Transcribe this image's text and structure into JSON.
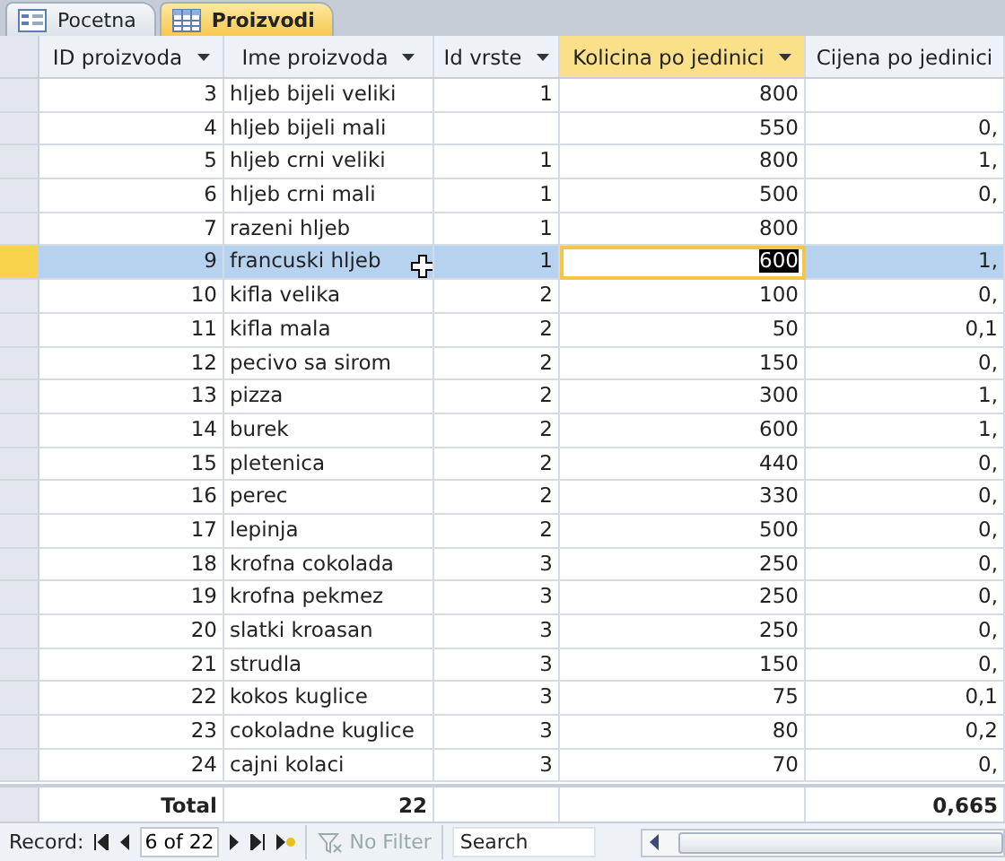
{
  "tabs": [
    {
      "label": "Pocetna",
      "kind": "form",
      "selected": false
    },
    {
      "label": "Proizvodi",
      "kind": "table",
      "selected": true
    }
  ],
  "table": {
    "columns": [
      {
        "label": "ID proizvoda",
        "selected": false,
        "dropdown": true
      },
      {
        "label": "Ime proizvoda",
        "selected": false,
        "dropdown": true
      },
      {
        "label": "Id vrste",
        "selected": false,
        "dropdown": true
      },
      {
        "label": "Kolicina po jedinici",
        "selected": true,
        "dropdown": true
      },
      {
        "label": "Cijena po jedinici",
        "selected": false,
        "dropdown": false
      }
    ],
    "rows": [
      {
        "cells": [
          "3",
          "hljeb bijeli veliki",
          "1",
          "800",
          null
        ],
        "selected": false
      },
      {
        "cells": [
          "4",
          "hljeb bijeli mali",
          null,
          "550",
          "0,"
        ],
        "selected": false
      },
      {
        "cells": [
          "5",
          "hljeb crni veliki",
          "1",
          "800",
          "1,"
        ],
        "selected": false
      },
      {
        "cells": [
          "6",
          "hljeb crni mali",
          "1",
          "500",
          "0,"
        ],
        "selected": false
      },
      {
        "cells": [
          "7",
          "razeni hljeb",
          "1",
          "800",
          null
        ],
        "selected": false
      },
      {
        "cells": [
          "9",
          "francuski hljeb",
          "1",
          "600",
          "1,"
        ],
        "selected": true
      },
      {
        "cells": [
          "10",
          "kifla velika",
          "2",
          "100",
          "0,"
        ],
        "selected": false
      },
      {
        "cells": [
          "11",
          "kifla mala",
          "2",
          "50",
          "0,1"
        ],
        "selected": false
      },
      {
        "cells": [
          "12",
          "pecivo sa sirom",
          "2",
          "150",
          "0,"
        ],
        "selected": false
      },
      {
        "cells": [
          "13",
          "pizza",
          "2",
          "300",
          "1,"
        ],
        "selected": false
      },
      {
        "cells": [
          "14",
          "burek",
          "2",
          "600",
          "1,"
        ],
        "selected": false
      },
      {
        "cells": [
          "15",
          "pletenica",
          "2",
          "440",
          "0,"
        ],
        "selected": false
      },
      {
        "cells": [
          "16",
          "perec",
          "2",
          "330",
          "0,"
        ],
        "selected": false
      },
      {
        "cells": [
          "17",
          "lepinja",
          "2",
          "500",
          "0,"
        ],
        "selected": false
      },
      {
        "cells": [
          "18",
          "krofna cokolada",
          "3",
          "250",
          "0,"
        ],
        "selected": false
      },
      {
        "cells": [
          "19",
          "krofna pekmez",
          "3",
          "250",
          "0,"
        ],
        "selected": false
      },
      {
        "cells": [
          "20",
          "slatki kroasan",
          "3",
          "250",
          "0,"
        ],
        "selected": false
      },
      {
        "cells": [
          "21",
          "strudla",
          "3",
          "150",
          "0,"
        ],
        "selected": false
      },
      {
        "cells": [
          "22",
          "kokos kuglice",
          "3",
          "75",
          "0,1"
        ],
        "selected": false
      },
      {
        "cells": [
          "23",
          "cokoladne kuglice",
          "3",
          "80",
          "0,2"
        ],
        "selected": false
      },
      {
        "cells": [
          "24",
          "cajni kolaci",
          "3",
          "70",
          "0,"
        ],
        "selected": false
      }
    ],
    "total": {
      "label": "Total",
      "count": "22",
      "sum": "0,665"
    }
  },
  "navigation": {
    "label": "Record:",
    "position": "6 of 22",
    "filter": "No Filter",
    "filter_disabled": true,
    "search_placeholder": "Search"
  }
}
